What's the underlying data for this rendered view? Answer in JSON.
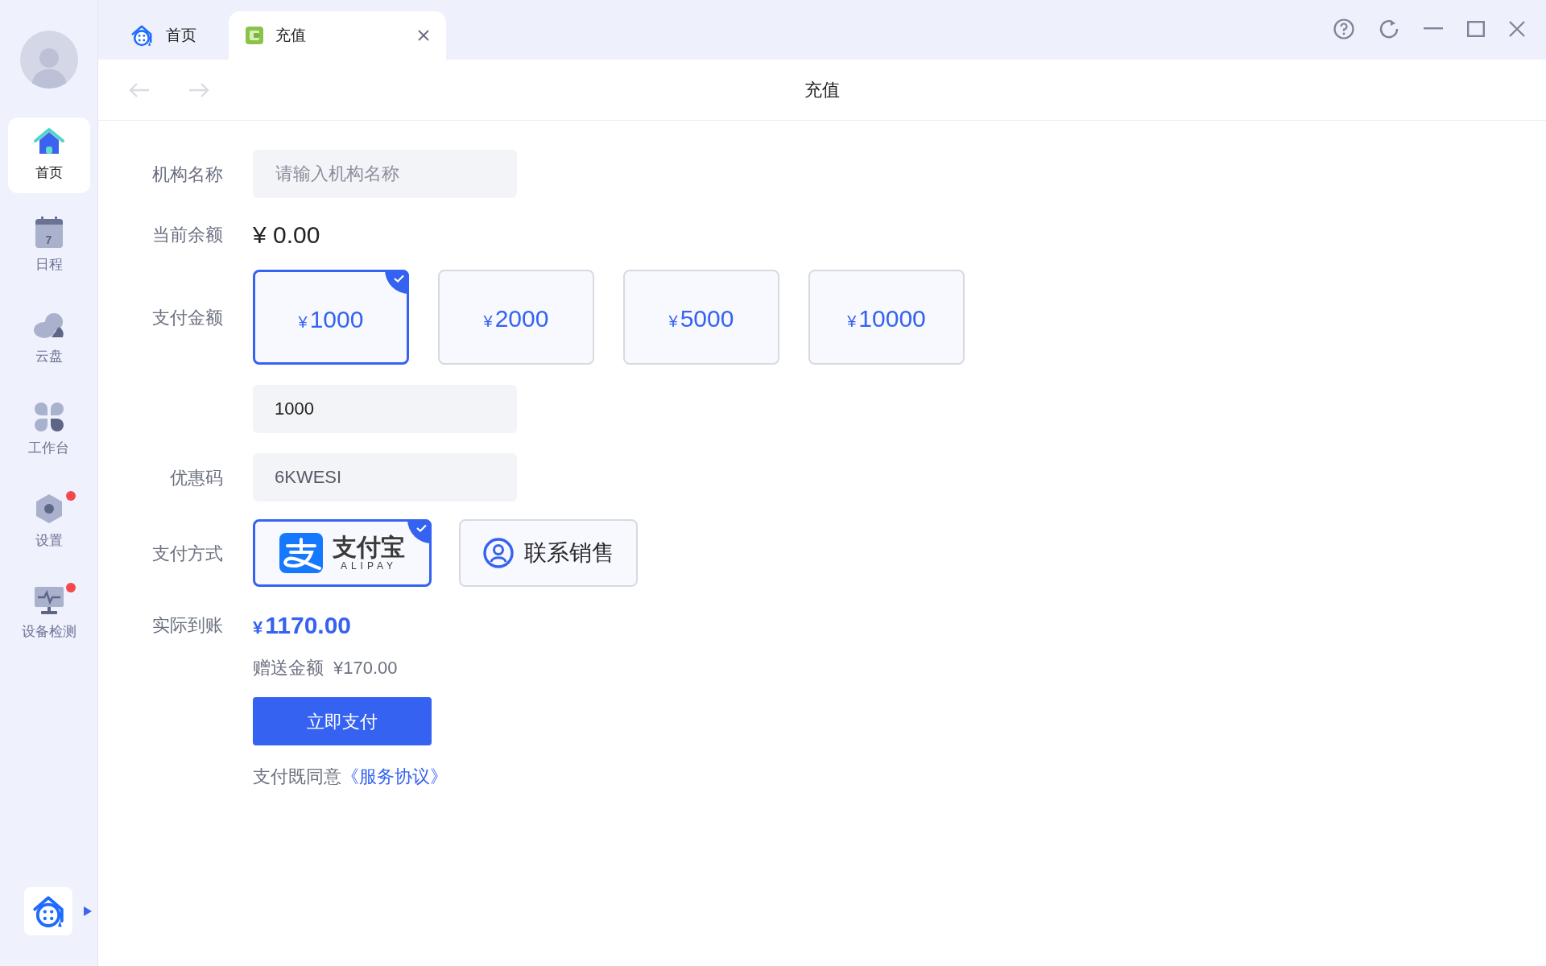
{
  "sidebar": {
    "items": [
      {
        "kind": "home",
        "label": "首页",
        "selected": true,
        "notification": false
      },
      {
        "kind": "calendar",
        "label": "日程",
        "selected": false,
        "notification": false,
        "icon_text": "7"
      },
      {
        "kind": "cloud",
        "label": "云盘",
        "selected": false,
        "notification": false
      },
      {
        "kind": "apps",
        "label": "工作台",
        "selected": false,
        "notification": false
      },
      {
        "kind": "settings",
        "label": "设置",
        "selected": false,
        "notification": true
      },
      {
        "kind": "monitor",
        "label": "设备检测",
        "selected": false,
        "notification": true
      }
    ]
  },
  "tabs": [
    {
      "kind": "home",
      "label": "首页",
      "selected": false,
      "closable": false
    },
    {
      "kind": "wallet",
      "label": "充值",
      "selected": true,
      "closable": true
    }
  ],
  "page": {
    "title": "充值"
  },
  "form": {
    "org_name": {
      "label": "机构名称",
      "placeholder": "请输入机构名称"
    },
    "balance": {
      "label": "当前余额",
      "value": "¥ 0.00"
    },
    "amount": {
      "label": "支付金额",
      "options": [
        {
          "currency": "¥",
          "value": "1000",
          "selected": true
        },
        {
          "currency": "¥",
          "value": "2000",
          "selected": false
        },
        {
          "currency": "¥",
          "value": "5000",
          "selected": false
        },
        {
          "currency": "¥",
          "value": "10000",
          "selected": false
        }
      ],
      "custom_value": "1000"
    },
    "coupon": {
      "label": "优惠码",
      "value": "6KWESI"
    },
    "payment": {
      "label": "支付方式",
      "options": [
        {
          "kind": "alipay",
          "title": "支付宝",
          "subtitle": "ALIPAY",
          "selected": true
        },
        {
          "kind": "contact",
          "title": "联系销售",
          "selected": false
        }
      ]
    },
    "actual": {
      "label": "实际到账",
      "currency": "¥",
      "value": "1170.00"
    },
    "bonus": {
      "label": "赠送金额",
      "value": "¥170.00"
    },
    "submit": "立即支付",
    "agreement": {
      "text": "支付既同意",
      "link": "《服务协议》"
    }
  }
}
